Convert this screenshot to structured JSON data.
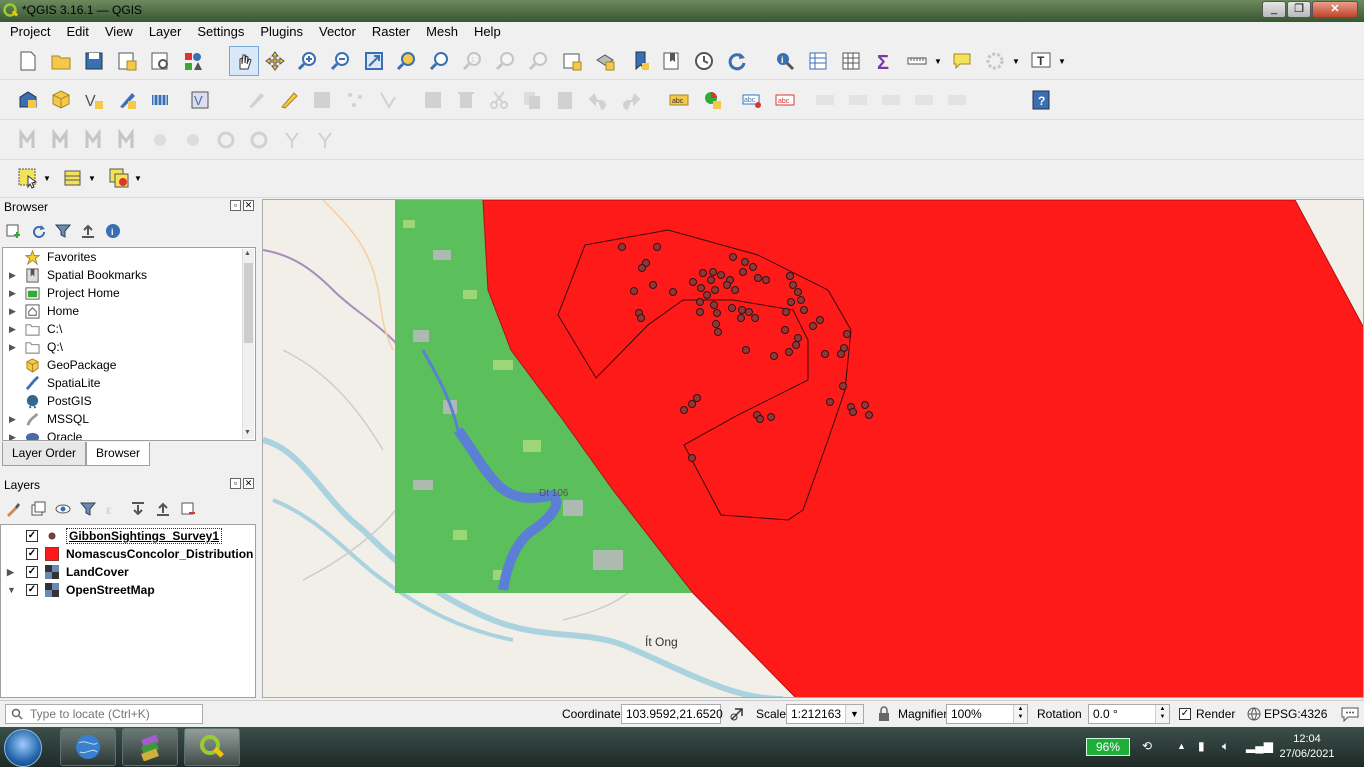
{
  "window": {
    "title": "*QGIS 3.16.1 — QGIS",
    "icon": "qgis-logo-icon"
  },
  "menu": [
    "Project",
    "Edit",
    "View",
    "Layer",
    "Settings",
    "Plugins",
    "Vector",
    "Raster",
    "Mesh",
    "Help"
  ],
  "browser": {
    "title": "Browser",
    "items": [
      {
        "label": "Favorites",
        "icon": "star-icon",
        "expandable": false
      },
      {
        "label": "Spatial Bookmarks",
        "icon": "bookmark-icon",
        "expandable": true
      },
      {
        "label": "Project Home",
        "icon": "project-home-icon",
        "expandable": true
      },
      {
        "label": "Home",
        "icon": "home-icon",
        "expandable": true
      },
      {
        "label": "C:\\",
        "icon": "folder-icon",
        "expandable": true
      },
      {
        "label": "Q:\\",
        "icon": "folder-icon",
        "expandable": true
      },
      {
        "label": "GeoPackage",
        "icon": "geopackage-icon",
        "expandable": false
      },
      {
        "label": "SpatiaLite",
        "icon": "spatialite-icon",
        "expandable": false
      },
      {
        "label": "PostGIS",
        "icon": "postgis-icon",
        "expandable": false
      },
      {
        "label": "MSSQL",
        "icon": "mssql-icon",
        "expandable": true
      },
      {
        "label": "Oracle",
        "icon": "oracle-icon",
        "expandable": true
      }
    ],
    "tabs": [
      "Layer Order",
      "Browser"
    ],
    "active_tab": "Browser"
  },
  "layers": {
    "title": "Layers",
    "items": [
      {
        "label": "GibbonSightings_Survey1",
        "symbol": "point",
        "checked": true,
        "selected": true
      },
      {
        "label": "NomascusConcolor_Distribution",
        "symbol": "polygon-fill",
        "checked": true,
        "selected": false
      },
      {
        "label": "LandCover",
        "symbol": "raster",
        "checked": true,
        "selected": false
      },
      {
        "label": "OpenStreetMap",
        "symbol": "raster",
        "checked": true,
        "selected": false
      }
    ]
  },
  "map": {
    "labels": {
      "town1": "Ít Ong",
      "town2": "Dt 106"
    },
    "colors": {
      "distribution_fill": "#ff1a1a",
      "landcover_green": "#5bbf5b",
      "water": "#5b7fd4",
      "osm_bg": "#f2efe9"
    }
  },
  "status": {
    "search_placeholder": "Type to locate (Ctrl+K)",
    "coordinate_label": "Coordinate",
    "coordinate": "103.9592,21.6520",
    "scale_label": "Scale",
    "scale": "1:212163",
    "magnifier_label": "Magnifier",
    "magnifier": "100%",
    "rotation_label": "Rotation",
    "rotation": "0.0 °",
    "render_label": "Render",
    "render_checked": true,
    "crs": "EPSG:4326"
  },
  "taskbar": {
    "battery": "96%",
    "time": "12:04",
    "date": "27/06/2021"
  }
}
